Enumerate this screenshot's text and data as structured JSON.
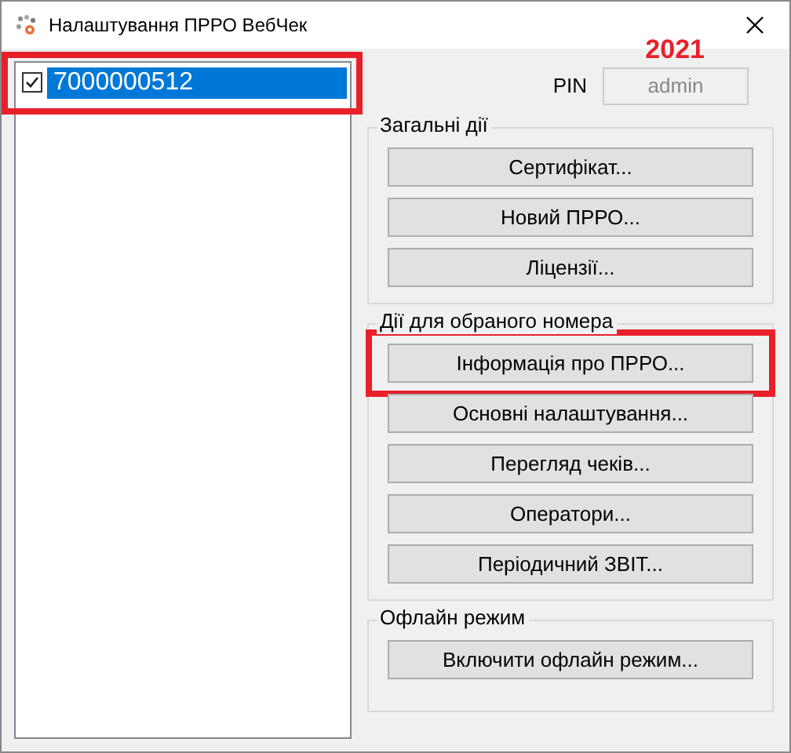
{
  "window": {
    "title": "Налаштування ПРРО ВебЧек"
  },
  "number_list": {
    "items": [
      {
        "label": "7000000512",
        "checked": true,
        "selected": true,
        "highlighted": true
      }
    ]
  },
  "pin": {
    "label": "PIN",
    "value": "admin",
    "annotation": "2021"
  },
  "groups": [
    {
      "title": "Загальні дії",
      "buttons": [
        {
          "label": "Сертифікат...",
          "highlighted": false
        },
        {
          "label": "Новий ПРРО...",
          "highlighted": false
        },
        {
          "label": "Ліцензії...",
          "highlighted": false
        }
      ]
    },
    {
      "title": "Дії для обраного номера",
      "buttons": [
        {
          "label": "Інформація про ПРРО...",
          "highlighted": true
        },
        {
          "label": "Основні налаштування...",
          "highlighted": false
        },
        {
          "label": "Перегляд чеків...",
          "highlighted": false
        },
        {
          "label": "Оператори...",
          "highlighted": false
        },
        {
          "label": "Періодичний ЗВІТ...",
          "highlighted": false
        }
      ]
    },
    {
      "title": "Офлайн режим",
      "buttons": [
        {
          "label": "Включити офлайн режим...",
          "highlighted": false
        }
      ]
    }
  ]
}
